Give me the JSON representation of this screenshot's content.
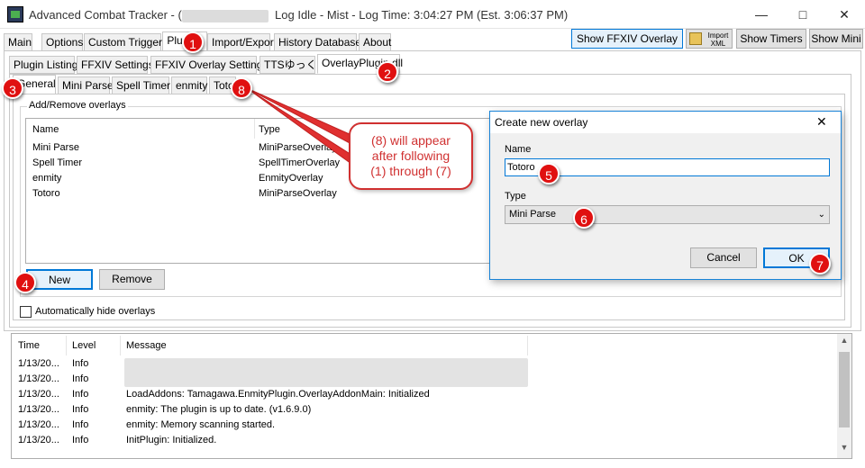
{
  "window": {
    "title_prefix": "Advanced Combat Tracker - (",
    "title_suffix": "Log Idle - Mist - Log Time: 3:04:27 PM (Est. 3:06:37 PM)"
  },
  "main_tabs": [
    "Main",
    "Options",
    "Custom Triggers",
    "Plugins",
    "Import/Export",
    "History Database",
    "About"
  ],
  "toolbar": {
    "show_ffxiv_overlay": "Show FFXIV Overlay",
    "import_xml_line1": "Import",
    "import_xml_line2": "XML",
    "show_timers": "Show Timers",
    "show_mini": "Show Mini"
  },
  "plugin_tabs": [
    "Plugin Listing",
    "FFXIV Settings",
    "FFXIV Overlay Settings",
    "TTSゆっくり",
    "OverlayPlugin.dll"
  ],
  "overlay_tabs": [
    "General",
    "Mini Parse",
    "Spell Timer",
    "enmity",
    "Totoro"
  ],
  "overlays": {
    "group_label": "Add/Remove overlays",
    "col_name": "Name",
    "col_type": "Type",
    "rows": [
      {
        "name": "Mini Parse",
        "type": "MiniParseOverlay"
      },
      {
        "name": "Spell Timer",
        "type": "SpellTimerOverlay"
      },
      {
        "name": "enmity",
        "type": "EnmityOverlay"
      },
      {
        "name": "Totoro",
        "type": "MiniParseOverlay"
      }
    ],
    "new_button": "New",
    "remove_button": "Remove",
    "auto_hide_label": "Automatically hide overlays"
  },
  "callout": {
    "line1": "(8) will appear",
    "line2": "after following",
    "line3": "(1) through (7)"
  },
  "dialog": {
    "title": "Create new overlay",
    "name_label": "Name",
    "name_value": "Totoro",
    "type_label": "Type",
    "type_value": "Mini Parse",
    "cancel": "Cancel",
    "ok": "OK"
  },
  "log": {
    "col_time": "Time",
    "col_level": "Level",
    "col_message": "Message",
    "rows": [
      {
        "time": "1/13/20...",
        "level": "Info",
        "message": ""
      },
      {
        "time": "1/13/20...",
        "level": "Info",
        "message": ""
      },
      {
        "time": "1/13/20...",
        "level": "Info",
        "message": "LoadAddons: Tamagawa.EnmityPlugin.OverlayAddonMain: Initialized"
      },
      {
        "time": "1/13/20...",
        "level": "Info",
        "message": "enmity: The plugin is up to date. (v1.6.9.0)"
      },
      {
        "time": "1/13/20...",
        "level": "Info",
        "message": "enmity: Memory scanning started."
      },
      {
        "time": "1/13/20...",
        "level": "Info",
        "message": "InitPlugin: Initialized."
      }
    ]
  },
  "badges": [
    "1",
    "2",
    "3",
    "4",
    "5",
    "6",
    "7",
    "8"
  ],
  "colors": {
    "badge_red": "#e01010",
    "accent_blue": "#0078d7",
    "callout_border": "#d03030"
  }
}
